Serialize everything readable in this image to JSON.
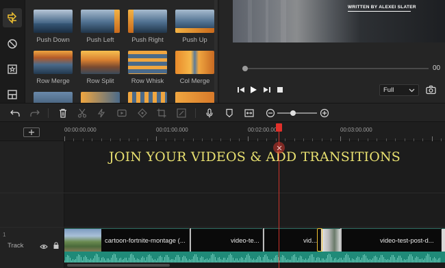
{
  "transitions": {
    "items": [
      {
        "label": "Push Down"
      },
      {
        "label": "Push Left"
      },
      {
        "label": "Push Right"
      },
      {
        "label": "Push Up"
      },
      {
        "label": "Row Merge"
      },
      {
        "label": "Row Split"
      },
      {
        "label": "Row Whisk"
      },
      {
        "label": "Col Merge"
      }
    ]
  },
  "preview": {
    "caption": "WRITTEN BY ALEXEI SLATER",
    "time_display": "00",
    "quality": "Full"
  },
  "timeline": {
    "ruler_labels": [
      "00:00:00.000",
      "00:01:00.000",
      "00:02:00.000",
      "00:03:00.000"
    ],
    "text_overlay": "JOIN YOUR VIDEOS & ADD TRANSITIONS",
    "track": {
      "number": "1",
      "name": "Track"
    },
    "clips": [
      {
        "label": "cartoon-fortnite-montage (..."
      },
      {
        "label": "video-te..."
      },
      {
        "label": "vid..."
      },
      {
        "label": "video-test-post-d..."
      }
    ]
  },
  "colors": {
    "accent": "#f2c230",
    "playhead": "#d0342c",
    "audio": "#1f8a78",
    "overlay_text": "#e8e070"
  }
}
